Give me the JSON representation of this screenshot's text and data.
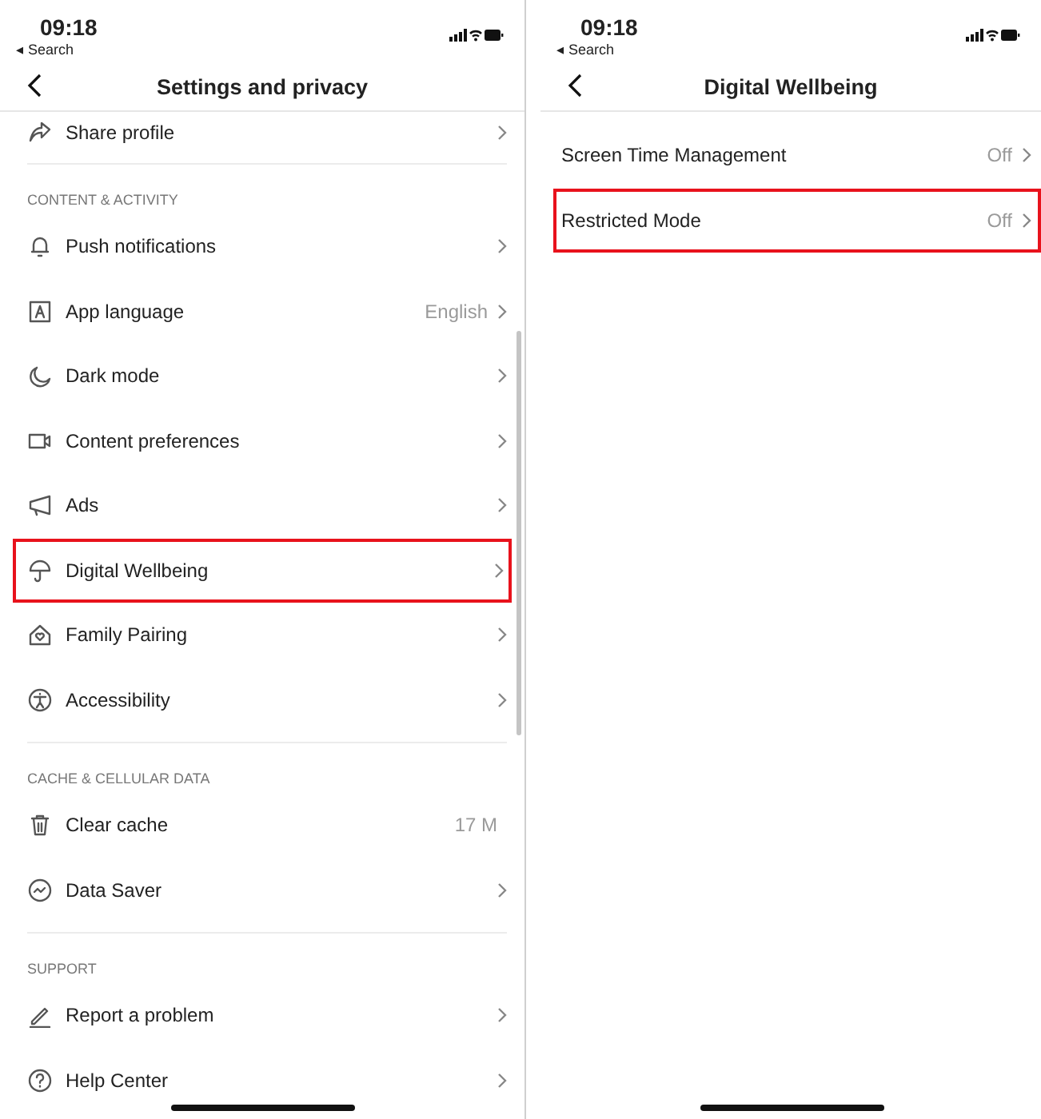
{
  "screens": [
    {
      "status_bar": {
        "time": "09:18",
        "back_label": "◂ Search"
      },
      "nav_title": "Settings and privacy",
      "sections": [
        {
          "items": [
            {
              "label": "Share profile",
              "highlighted": false
            }
          ]
        },
        {
          "header": "CONTENT & ACTIVITY",
          "items": [
            {
              "label": "Push notifications",
              "highlighted": false
            },
            {
              "label": "App language",
              "value": "English",
              "highlighted": false
            },
            {
              "label": "Dark mode",
              "highlighted": false
            },
            {
              "label": "Content preferences",
              "highlighted": false
            },
            {
              "label": "Ads",
              "highlighted": false
            },
            {
              "label": "Digital Wellbeing",
              "highlighted": true
            },
            {
              "label": "Family Pairing",
              "highlighted": false
            },
            {
              "label": "Accessibility",
              "highlighted": false
            }
          ]
        },
        {
          "header": "CACHE & CELLULAR DATA",
          "items": [
            {
              "label": "Clear cache",
              "value": "17 M",
              "chevron": false,
              "highlighted": false
            },
            {
              "label": "Data Saver",
              "highlighted": false
            }
          ]
        },
        {
          "header": "SUPPORT",
          "items": [
            {
              "label": "Report a problem",
              "highlighted": false
            },
            {
              "label": "Help Center",
              "highlighted": false
            }
          ]
        }
      ]
    },
    {
      "status_bar": {
        "time": "09:18",
        "back_label": "◂ Search"
      },
      "nav_title": "Digital Wellbeing",
      "sections": [
        {
          "items": [
            {
              "label": "Screen Time Management",
              "value": "Off",
              "highlighted": false
            },
            {
              "label": "Restricted Mode",
              "value": "Off",
              "highlighted": true
            }
          ]
        }
      ]
    }
  ]
}
